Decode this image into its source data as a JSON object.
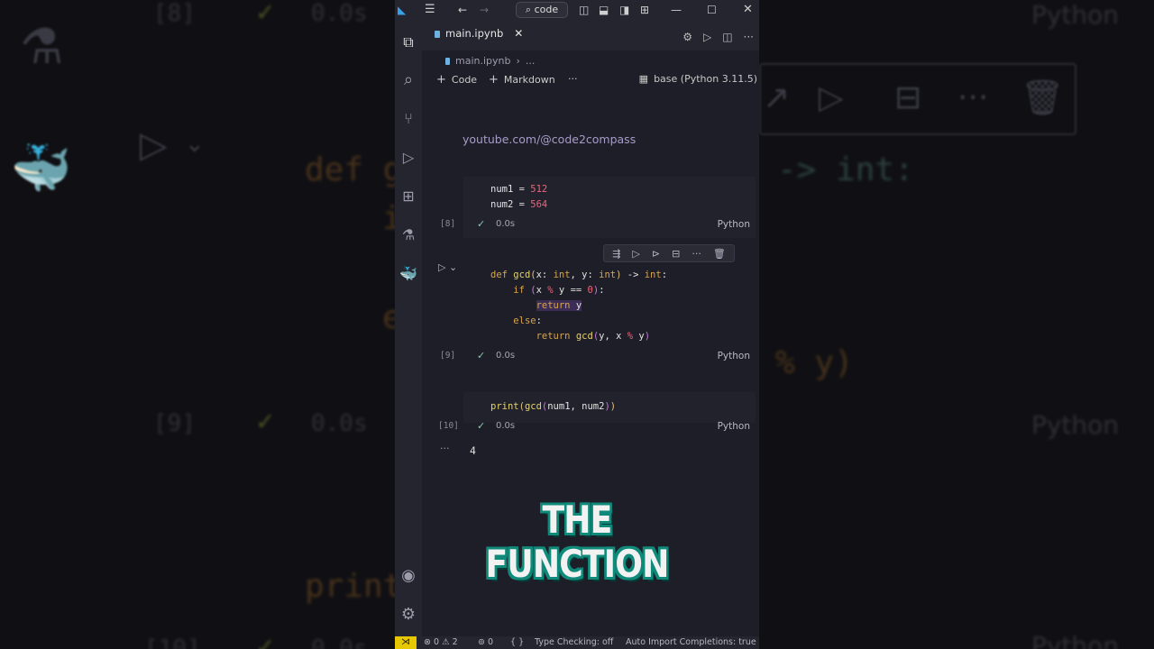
{
  "background": {
    "left_exec_count_top": "[8]",
    "left_time_top": "0.0s",
    "left_code_1": "def g",
    "left_code_2": "i",
    "left_code_3": "e",
    "left_exec_count_mid": "[9]",
    "left_time_mid": "0.0s",
    "left_code_print": "print",
    "left_exec_count_bottom": "[10]",
    "left_time_bottom": "0.0s",
    "right_lang_top": "Python",
    "right_code_arrow": "-> int:",
    "right_code_mod": "% y)",
    "right_lang_mid": "Python",
    "right_lang_bottom": "Python"
  },
  "titlebar": {
    "command_center": "code"
  },
  "tab": {
    "filename": "main.ipynb"
  },
  "breadcrumb": {
    "file": "main.ipynb",
    "more": "..."
  },
  "notebook_toolbar": {
    "add_code": "Code",
    "add_markdown": "Markdown",
    "more": "···",
    "kernel": "base (Python 3.11.5)"
  },
  "markdown_output": "youtube.com/@code2compass",
  "cells": [
    {
      "exec_count": "[8]",
      "time": "0.0s",
      "lang": "Python"
    },
    {
      "exec_count": "[9]",
      "time": "0.0s",
      "lang": "Python"
    },
    {
      "exec_count": "[10]",
      "time": "0.0s",
      "lang": "Python",
      "output": "4"
    }
  ],
  "output_more": "···",
  "caption": "THE FUNCTION",
  "statusbar": {
    "errors": "0",
    "warnings": "2",
    "ports": "0",
    "braces": "{ }",
    "type_checking": "Type Checking: off",
    "auto_import": "Auto Import Completions: true"
  },
  "colors": {
    "editor_bg": "#1e1e28",
    "cell_bg": "#22222d",
    "keyword": "#d9a54b",
    "number": "#e8667a",
    "check": "#7fd1a6",
    "caption_outline": "#0f8a7a"
  },
  "icons": {
    "activity": [
      "explorer-icon",
      "search-icon",
      "source-control-icon",
      "run-debug-icon",
      "extensions-icon",
      "testing-icon",
      "docker-icon",
      "accounts-icon",
      "settings-gear-icon"
    ]
  }
}
